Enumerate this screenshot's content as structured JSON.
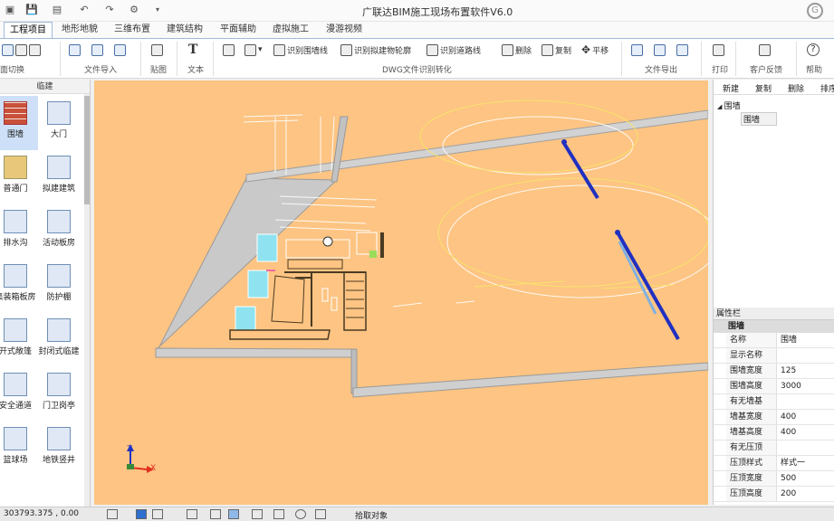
{
  "app": {
    "title": "广联达BIM施工现场布置软件V6.0"
  },
  "tabs": [
    "工程项目",
    "地形地貌",
    "三维布置",
    "建筑结构",
    "平面辅助",
    "虚拟施工",
    "漫游视频"
  ],
  "ribbon": {
    "buttons": {
      "recognize_wall": "识别围墙线",
      "recognize_building": "识别拟建物轮廓",
      "recognize_road": "识别道路线",
      "delete": "删除",
      "copy": "复制",
      "move": "平移",
      "print": "打印",
      "feedback": "客户反馈",
      "help": "帮助",
      "text_icon": "T"
    },
    "groups": {
      "switch": "面切换",
      "file_import": "文件导入",
      "paste": "贴图",
      "text": "文本",
      "dwg": "DWG文件识别转化",
      "file_export": "文件导出"
    }
  },
  "left_panel": {
    "header": "临建",
    "items": [
      {
        "label": "围墙",
        "selected": true
      },
      {
        "label": "大门"
      },
      {
        "label": "普通门"
      },
      {
        "label": "拟建建筑"
      },
      {
        "label": "排水沟"
      },
      {
        "label": "活动板房"
      },
      {
        "label": "集装箱板房"
      },
      {
        "label": "防护棚"
      },
      {
        "label": "开式敞篷"
      },
      {
        "label": "封闭式临建"
      },
      {
        "label": "安全通道"
      },
      {
        "label": "门卫岗亭"
      },
      {
        "label": "篮球场"
      },
      {
        "label": "地铁竖井"
      }
    ]
  },
  "right_panel": {
    "toolbar": [
      "新建",
      "复制",
      "删除",
      "排序"
    ],
    "tree": {
      "parent": "围墙",
      "child": "围墙"
    },
    "properties": {
      "header": "属性栏",
      "group": "围墙",
      "rows": [
        {
          "key": "名称",
          "value": "围墙"
        },
        {
          "key": "显示名称",
          "value": ""
        },
        {
          "key": "围墙宽度",
          "value": "125"
        },
        {
          "key": "围墙高度",
          "value": "3000"
        },
        {
          "key": "有无墙基",
          "value": ""
        },
        {
          "key": "墙基宽度",
          "value": "400"
        },
        {
          "key": "墙基高度",
          "value": "400"
        },
        {
          "key": "有无压顶",
          "value": ""
        },
        {
          "key": "压顶样式",
          "value": "样式一"
        },
        {
          "key": "压顶宽度",
          "value": "500"
        },
        {
          "key": "压顶高度",
          "value": "200"
        }
      ]
    }
  },
  "viewport": {
    "axis_x": "X",
    "axis_z": "Z",
    "ground_color": "#fdc483",
    "wall_color": "#c9c9c9"
  },
  "status": {
    "coords": "303793.375 , 0.00",
    "snap": "拾取对象"
  }
}
